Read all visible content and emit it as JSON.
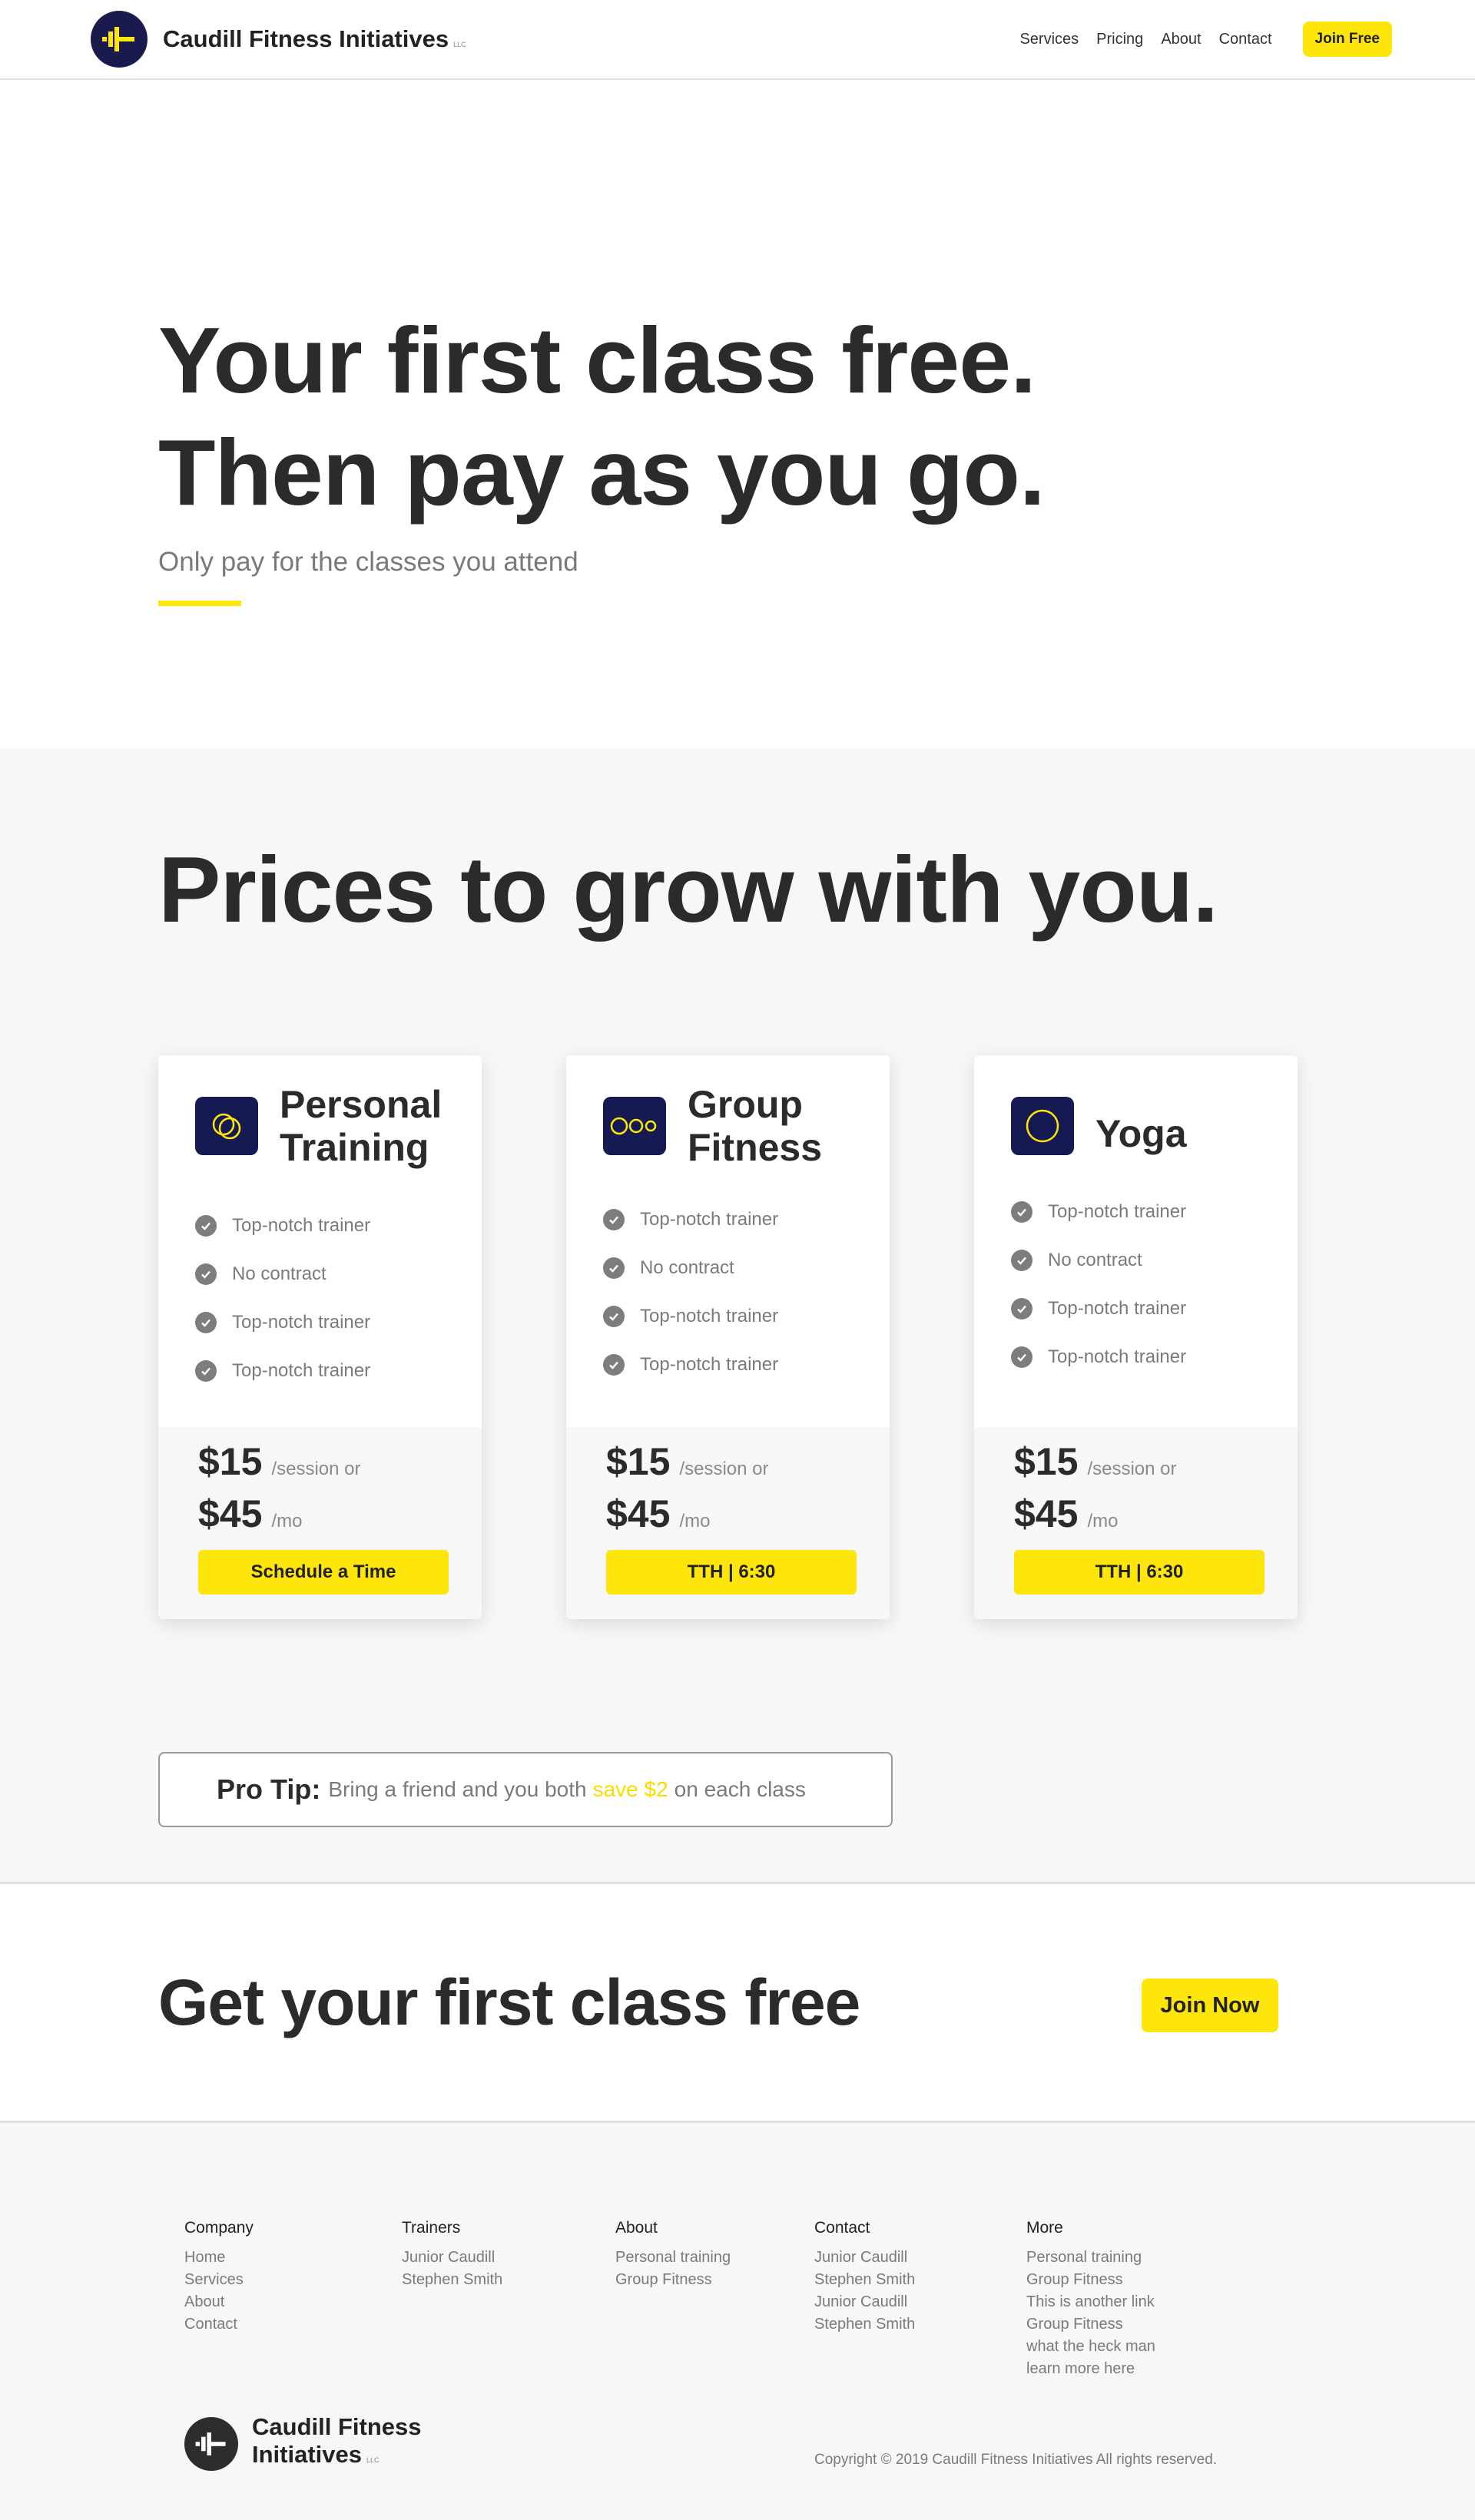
{
  "header": {
    "brand": "Caudill Fitness Initiatives",
    "brand_suffix": "LLC",
    "nav": [
      "Services",
      "Pricing",
      "About",
      "Contact"
    ],
    "cta": "Join Free"
  },
  "hero": {
    "line1": "Your first class free.",
    "line2": "Then pay as you go.",
    "subtitle": "Only pay for the classes you attend"
  },
  "pricing": {
    "heading": "Prices to grow with you.",
    "cards": [
      {
        "title_line1": "Personal",
        "title_line2": "Training",
        "icon": "double-circle-icon",
        "features": [
          "Top-notch trainer",
          "No contract",
          "Top-notch trainer",
          "Top-notch trainer"
        ],
        "price_session": "$15",
        "session_label": "/session or",
        "price_month": "$45",
        "month_label": "/mo",
        "button": "Schedule a Time"
      },
      {
        "title_line1": "Group",
        "title_line2": "Fitness",
        "icon": "three-circles-icon",
        "features": [
          "Top-notch trainer",
          "No contract",
          "Top-notch trainer",
          "Top-notch trainer"
        ],
        "price_session": "$15",
        "session_label": "/session or",
        "price_month": "$45",
        "month_label": "/mo",
        "button": "TTH | 6:30"
      },
      {
        "title_line1": "Yoga",
        "title_line2": "",
        "icon": "circle-icon",
        "features": [
          "Top-notch trainer",
          "No contract",
          "Top-notch trainer",
          "Top-notch trainer"
        ],
        "price_session": "$15",
        "session_label": "/session or",
        "price_month": "$45",
        "month_label": "/mo",
        "button": "TTH | 6:30"
      }
    ],
    "protip": {
      "label": "Pro Tip:",
      "text_before": "Bring a friend and you both",
      "highlight": "save $2",
      "text_after": "on each class"
    }
  },
  "cta": {
    "heading": "Get your first class free",
    "button": "Join Now"
  },
  "footer": {
    "columns": [
      {
        "title": "Company",
        "links": [
          "Home",
          "Services",
          "About",
          "Contact"
        ]
      },
      {
        "title": "Trainers",
        "links": [
          "Junior Caudill",
          "Stephen Smith"
        ]
      },
      {
        "title": "About",
        "links": [
          "Personal training",
          "Group Fitness"
        ]
      },
      {
        "title": "Contact",
        "links": [
          "Junior Caudill",
          "Stephen Smith",
          "Junior Caudill",
          "Stephen Smith"
        ]
      },
      {
        "title": "More",
        "links": [
          "Personal training",
          "Group Fitness",
          "This is another link",
          "Group Fitness",
          "what the heck man",
          "learn more here"
        ]
      }
    ],
    "brand_line1": "Caudill Fitness",
    "brand_line2": "Initiatives",
    "brand_suffix": "LLC",
    "copyright": "Copyright © 2019 Caudill Fitness Initiatives All rights reserved."
  },
  "colors": {
    "accent": "#ffe60a",
    "navy": "#151a52",
    "text": "#2b2b2b",
    "muted": "#7a7a7a",
    "section_bg": "#f7f7f7"
  }
}
